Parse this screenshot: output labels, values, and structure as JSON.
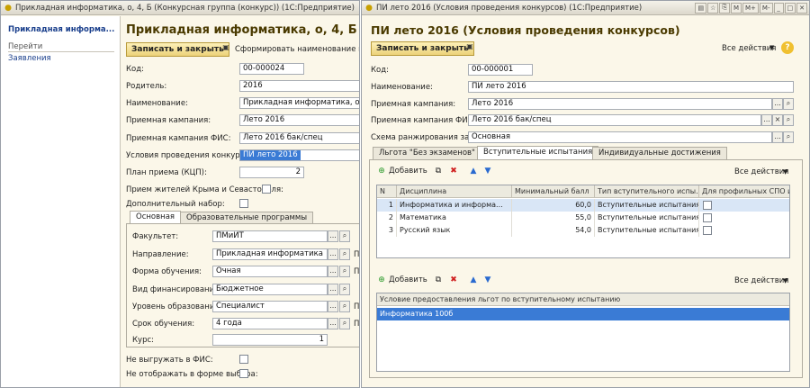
{
  "left_window": {
    "title": "Прикладная информатика, о, 4, Б (Конкурсная группа (конкурс)) (1С:Предприятие)",
    "nav": {
      "header": "Прикладная информа...",
      "section": "Перейти",
      "item": "Заявления"
    },
    "form_title": "Прикладная информатика, о, 4, Б (Конку",
    "save_close": "Записать и закрыть",
    "form_name_link": "Сформировать наименование по ш",
    "fields": {
      "code": {
        "label": "Код:",
        "value": "00-000024"
      },
      "parent": {
        "label": "Родитель:",
        "value": "2016"
      },
      "name": {
        "label": "Наименование:",
        "value": "Прикладная информатика, о, 4, Б"
      },
      "campaign": {
        "label": "Приемная кампания:",
        "value": "Лето 2016"
      },
      "campaign_fis": {
        "label": "Приемная кампания ФИС:",
        "value": "Лето 2016 бак/спец"
      },
      "conditions": {
        "label": "Условия проведения конкурса:",
        "value": "ПИ лето 2016"
      },
      "plan": {
        "label": "План приема (КЦП):",
        "value": "2"
      },
      "crimea": {
        "label": "Прием жителей Крыма и Севастополя:"
      },
      "extra": {
        "label": "Дополнительный набор:"
      }
    },
    "tabs": [
      "Основная",
      "Образовательные программы"
    ],
    "tab_fields": {
      "faculty": {
        "label": "Факультет:",
        "value": "ПМиИТ"
      },
      "direction": {
        "label": "Направление:",
        "value": "Прикладная информатика"
      },
      "study_form": {
        "label": "Форма обучения:",
        "value": "Очная"
      },
      "funding": {
        "label": "Вид финансирования:",
        "value": "Бюджетное"
      },
      "level": {
        "label": "Уровень образования:",
        "value": "Специалист"
      },
      "duration": {
        "label": "Срок обучения:",
        "value": "4 года"
      },
      "course": {
        "label": "Курс:",
        "value": "1"
      }
    },
    "side_letters": [
      "П",
      "П",
      "П",
      "П"
    ],
    "no_fis": "Не выгружать в ФИС:",
    "no_display": "Не отображать в форме выбора:"
  },
  "right_window": {
    "title": "ПИ лето 2016 (Условия проведения конкурсов) (1С:Предприятие)",
    "title_buttons": [
      "M",
      "M+",
      "M-",
      "_",
      "□",
      "✕"
    ],
    "form_title": "ПИ лето 2016 (Условия проведения конкурсов)",
    "save_close": "Записать и закрыть",
    "all_actions": "Все действия",
    "help": "?",
    "fields": {
      "code": {
        "label": "Код:",
        "value": "00-000001"
      },
      "name": {
        "label": "Наименование:",
        "value": "ПИ лето 2016"
      },
      "campaign": {
        "label": "Приемная кампания:",
        "value": "Лето 2016"
      },
      "campaign_fis": {
        "label": "Приемная кампания ФИС:",
        "value": "Лето 2016 бак/спец"
      },
      "ranking": {
        "label": "Схема ранжирования заявлений:",
        "value": "Основная"
      }
    },
    "tabs": [
      "Льгота \"Без экзаменов\"",
      "Вступительные испытания",
      "Индивидуальные достижения"
    ],
    "add_label": "Добавить",
    "grid1": {
      "columns": [
        "N",
        "Дисциплина",
        "Минимальный балл",
        "Тип вступительного испы...",
        "Для профильных СПО и ВО"
      ],
      "rows": [
        {
          "n": "1",
          "discipline": "Информатика и информа...",
          "score": "60,0",
          "type": "Вступительные испытания"
        },
        {
          "n": "2",
          "discipline": "Математика",
          "score": "55,0",
          "type": "Вступительные испытания"
        },
        {
          "n": "3",
          "discipline": "Русский язык",
          "score": "54,0",
          "type": "Вступительные испытания"
        }
      ]
    },
    "grid2": {
      "column": "Условие предоставления льгот по вступительному испытанию",
      "rows": [
        "Информатика 100б"
      ]
    }
  }
}
